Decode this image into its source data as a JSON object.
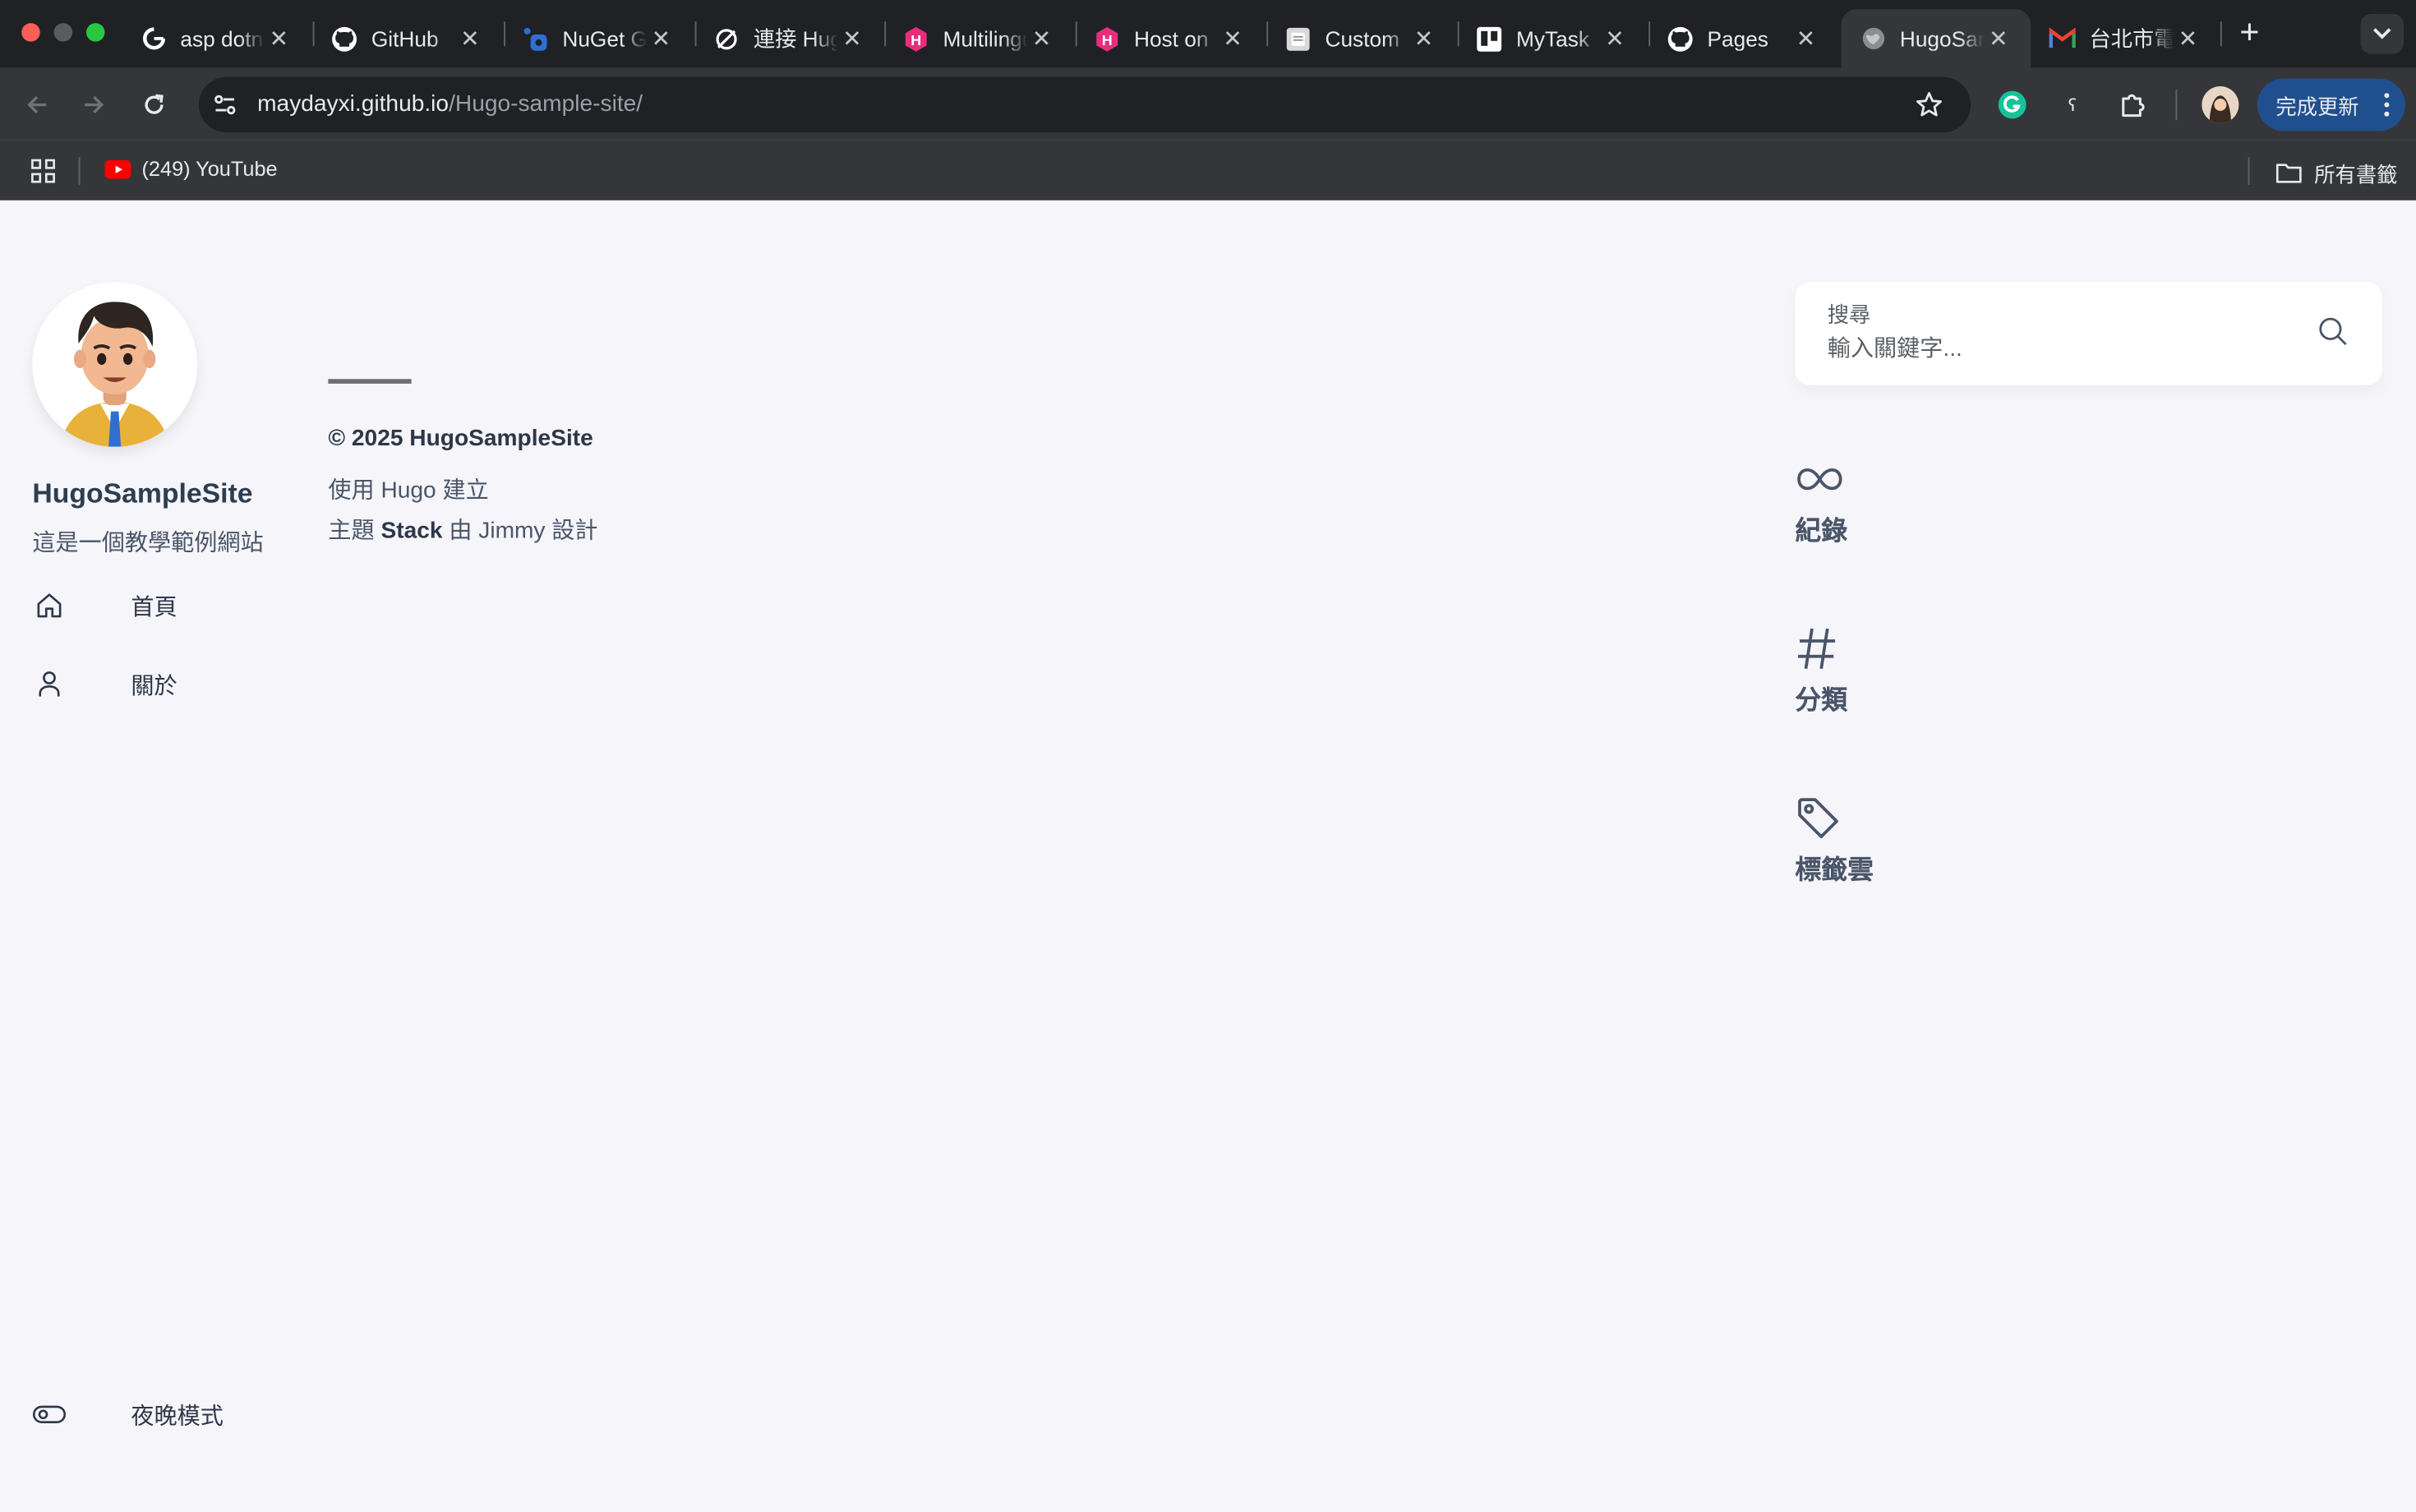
{
  "browser": {
    "tabs": [
      {
        "title": "asp dotnet",
        "icon": "google-icon"
      },
      {
        "title": "GitHub",
        "icon": "github-icon"
      },
      {
        "title": "NuGet Gallery",
        "icon": "nuget-icon"
      },
      {
        "title": "連接 Hugo",
        "icon": "link-icon"
      },
      {
        "title": "Multilingual",
        "icon": "hugo-icon"
      },
      {
        "title": "Host on",
        "icon": "hugo-icon"
      },
      {
        "title": "Custom",
        "icon": "document-icon"
      },
      {
        "title": "MyTask",
        "icon": "trello-icon"
      },
      {
        "title": "Pages",
        "icon": "github-icon"
      },
      {
        "title": "HugoSampleSite",
        "icon": "globe-icon",
        "active": true
      },
      {
        "title": "台北市電",
        "icon": "gmail-icon"
      }
    ],
    "url_host": "maydayxi.github.io",
    "url_path": "/Hugo-sample-site/",
    "update_button": "完成更新",
    "bookmarks": {
      "youtube": "(249) YouTube",
      "all_bookmarks": "所有書籤"
    }
  },
  "site": {
    "title": "HugoSampleSite",
    "description": "這是一個教學範例網站",
    "menu": {
      "home": "首頁",
      "about": "關於",
      "dark_mode": "夜晚模式"
    }
  },
  "footer": {
    "copyright": "© 2025 HugoSampleSite",
    "built_with": "使用 Hugo 建立",
    "theme_prefix": "主題 ",
    "theme_name": "Stack",
    "theme_suffix": " 由 Jimmy 設計"
  },
  "sidebar_right": {
    "search_label": "搜尋",
    "search_placeholder": "輸入關鍵字...",
    "widgets": {
      "archives": "紀錄",
      "categories": "分類",
      "tags": "標籤雲"
    }
  }
}
